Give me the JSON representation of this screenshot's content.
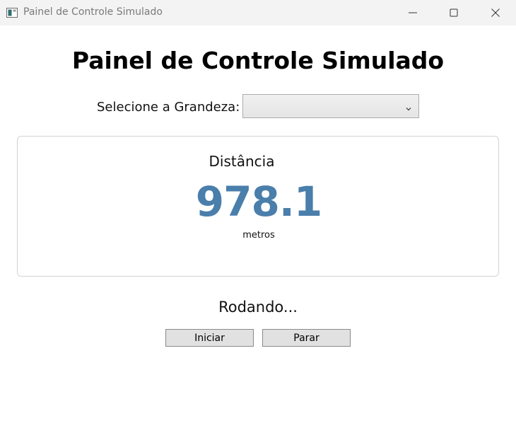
{
  "window": {
    "title": "Painel de Controle Simulado",
    "icon": "window-app-icon",
    "controls": [
      "minimize-icon",
      "maximize-icon",
      "close-icon"
    ]
  },
  "header": {
    "title": "Painel de Controle Simulado"
  },
  "selector": {
    "label": "Selecione a Grandeza:",
    "value": ""
  },
  "readout": {
    "name": "Distância",
    "value": "978.1",
    "unit": "metros",
    "value_color": "#4a7eab"
  },
  "status": {
    "text": "Rodando..."
  },
  "buttons": {
    "start_label": "Iniciar",
    "stop_label": "Parar"
  }
}
